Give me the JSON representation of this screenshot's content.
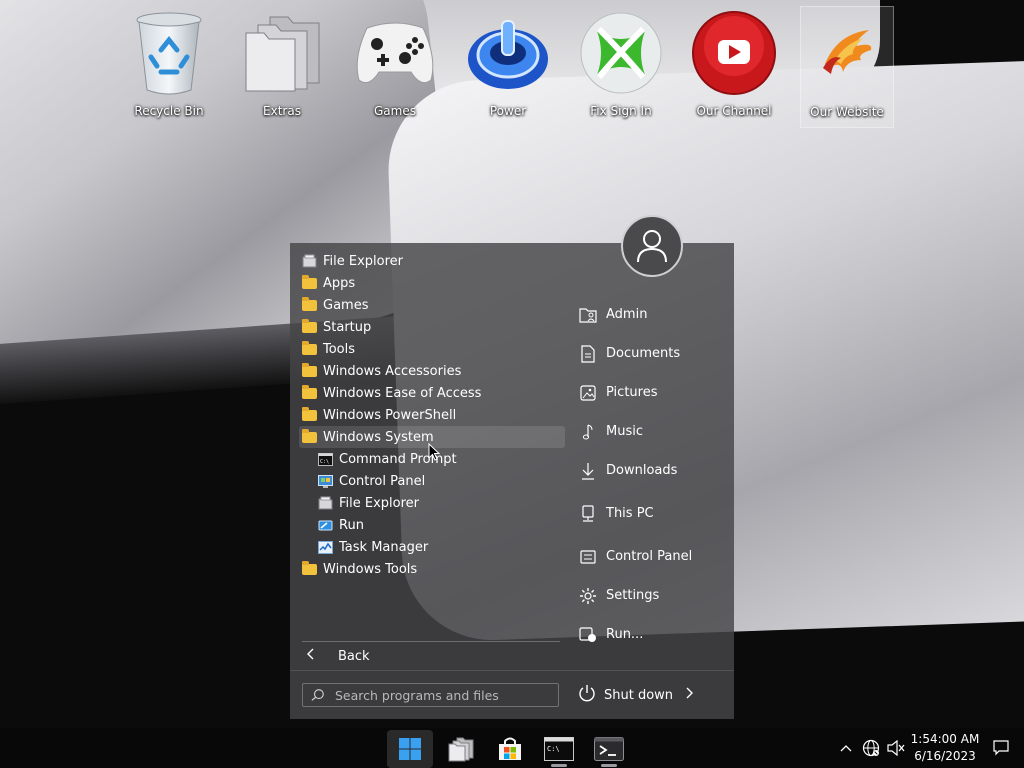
{
  "desktop": {
    "icons": [
      {
        "label": "Recycle Bin",
        "icon": "recycle-bin-icon"
      },
      {
        "label": "Extras",
        "icon": "folder-stack-icon"
      },
      {
        "label": "Games",
        "icon": "gamepad-icon"
      },
      {
        "label": "Power",
        "icon": "power-orb-icon"
      },
      {
        "label": "Fix Sign In",
        "icon": "xbox-icon"
      },
      {
        "label": "Our Channel",
        "icon": "youtube-icon"
      },
      {
        "label": "Our Website",
        "icon": "phoenix-logo-icon"
      }
    ]
  },
  "start_menu": {
    "programs": [
      {
        "label": "File Explorer",
        "icon": "file-explorer-icon"
      },
      {
        "label": "Apps",
        "icon": "folder-icon"
      },
      {
        "label": "Games",
        "icon": "folder-icon"
      },
      {
        "label": "Startup",
        "icon": "folder-icon"
      },
      {
        "label": "Tools",
        "icon": "folder-icon"
      },
      {
        "label": "Windows Accessories",
        "icon": "folder-icon"
      },
      {
        "label": "Windows Ease of Access",
        "icon": "folder-icon"
      },
      {
        "label": "Windows PowerShell",
        "icon": "folder-icon"
      },
      {
        "label": "Windows System",
        "icon": "folder-icon"
      },
      {
        "label": "Command Prompt",
        "icon": "command-prompt-icon"
      },
      {
        "label": "Control Panel",
        "icon": "control-panel-icon"
      },
      {
        "label": "File Explorer",
        "icon": "file-explorer-icon"
      },
      {
        "label": "Run",
        "icon": "run-icon"
      },
      {
        "label": "Task Manager",
        "icon": "task-manager-icon"
      },
      {
        "label": "Windows Tools",
        "icon": "folder-icon"
      }
    ],
    "back_label": "Back",
    "search_placeholder": "Search programs and files",
    "places": [
      {
        "label": "Admin",
        "icon": "user-folder-icon"
      },
      {
        "label": "Documents",
        "icon": "document-icon"
      },
      {
        "label": "Pictures",
        "icon": "picture-icon"
      },
      {
        "label": "Music",
        "icon": "music-note-icon"
      },
      {
        "label": "Downloads",
        "icon": "download-icon"
      },
      {
        "label": "This PC",
        "icon": "computer-icon"
      },
      {
        "label": "Control Panel",
        "icon": "control-panel-icon"
      },
      {
        "label": "Settings",
        "icon": "gear-icon"
      },
      {
        "label": "Run...",
        "icon": "run-icon"
      }
    ],
    "shutdown_label": "Shut down"
  },
  "taskbar": {
    "apps": [
      {
        "name": "start",
        "icon": "windows-logo-icon",
        "active": true
      },
      {
        "name": "file-explorer",
        "icon": "folder-stack-icon",
        "active": false
      },
      {
        "name": "microsoft-store",
        "icon": "store-icon",
        "active": false
      },
      {
        "name": "command-prompt",
        "icon": "command-prompt-icon",
        "active": false
      },
      {
        "name": "terminal",
        "icon": "terminal-icon",
        "active": false
      }
    ],
    "clock": {
      "time": "1:54:00 AM",
      "date": "6/16/2023"
    }
  }
}
